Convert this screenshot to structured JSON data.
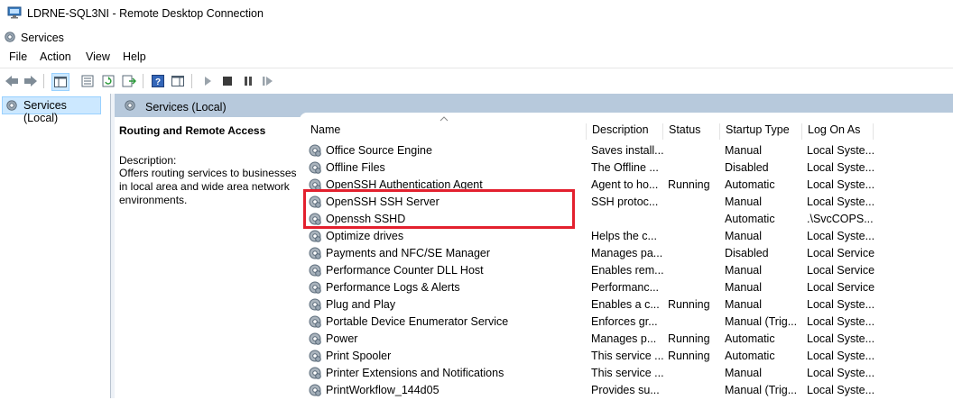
{
  "window": {
    "title": "LDRNE-SQL3NI - Remote Desktop Connection"
  },
  "app": {
    "title": "Services"
  },
  "menu": [
    "File",
    "Action",
    "View",
    "Help"
  ],
  "tree": {
    "item": "Services (Local)"
  },
  "pane_header": "Services (Local)",
  "description_panel": {
    "service_title": "Routing and Remote Access",
    "label": "Description:",
    "text": "Offers routing services to businesses in local area and wide area network environments."
  },
  "columns": [
    "Name",
    "Description",
    "Status",
    "Startup Type",
    "Log On As"
  ],
  "rows": [
    {
      "name": "Office  Source Engine",
      "description": "Saves install...",
      "status": "",
      "startup": "Manual",
      "logon": "Local Syste..."
    },
    {
      "name": "Offline Files",
      "description": "The Offline ...",
      "status": "",
      "startup": "Disabled",
      "logon": "Local Syste..."
    },
    {
      "name": "OpenSSH Authentication Agent",
      "description": "Agent to ho...",
      "status": "Running",
      "startup": "Automatic",
      "logon": "Local Syste..."
    },
    {
      "name": "OpenSSH SSH Server",
      "description": "SSH protoc...",
      "status": "",
      "startup": "Manual",
      "logon": "Local Syste..."
    },
    {
      "name": "Openssh SSHD",
      "description": "",
      "status": "",
      "startup": "Automatic",
      "logon": ".\\SvcCOPS..."
    },
    {
      "name": "Optimize drives",
      "description": "Helps the c...",
      "status": "",
      "startup": "Manual",
      "logon": "Local Syste..."
    },
    {
      "name": "Payments and NFC/SE Manager",
      "description": "Manages pa...",
      "status": "",
      "startup": "Disabled",
      "logon": "Local Service"
    },
    {
      "name": "Performance Counter DLL Host",
      "description": "Enables rem...",
      "status": "",
      "startup": "Manual",
      "logon": "Local Service"
    },
    {
      "name": "Performance Logs & Alerts",
      "description": "Performanc...",
      "status": "",
      "startup": "Manual",
      "logon": "Local Service"
    },
    {
      "name": "Plug and Play",
      "description": "Enables a c...",
      "status": "Running",
      "startup": "Manual",
      "logon": "Local Syste..."
    },
    {
      "name": "Portable Device Enumerator Service",
      "description": "Enforces gr...",
      "status": "",
      "startup": "Manual (Trig...",
      "logon": "Local Syste..."
    },
    {
      "name": "Power",
      "description": "Manages p...",
      "status": "Running",
      "startup": "Automatic",
      "logon": "Local Syste..."
    },
    {
      "name": "Print Spooler",
      "description": "This service ...",
      "status": "Running",
      "startup": "Automatic",
      "logon": "Local Syste..."
    },
    {
      "name": "Printer Extensions and Notifications",
      "description": "This service ...",
      "status": "",
      "startup": "Manual",
      "logon": "Local Syste..."
    },
    {
      "name": "PrintWorkflow_144d05",
      "description": "Provides su...",
      "status": "",
      "startup": "Manual (Trig...",
      "logon": "Local Syste..."
    }
  ],
  "colors": {
    "highlight": "#e3202e",
    "pane_header": "#b7c9dc",
    "selection": "#cce8ff"
  }
}
